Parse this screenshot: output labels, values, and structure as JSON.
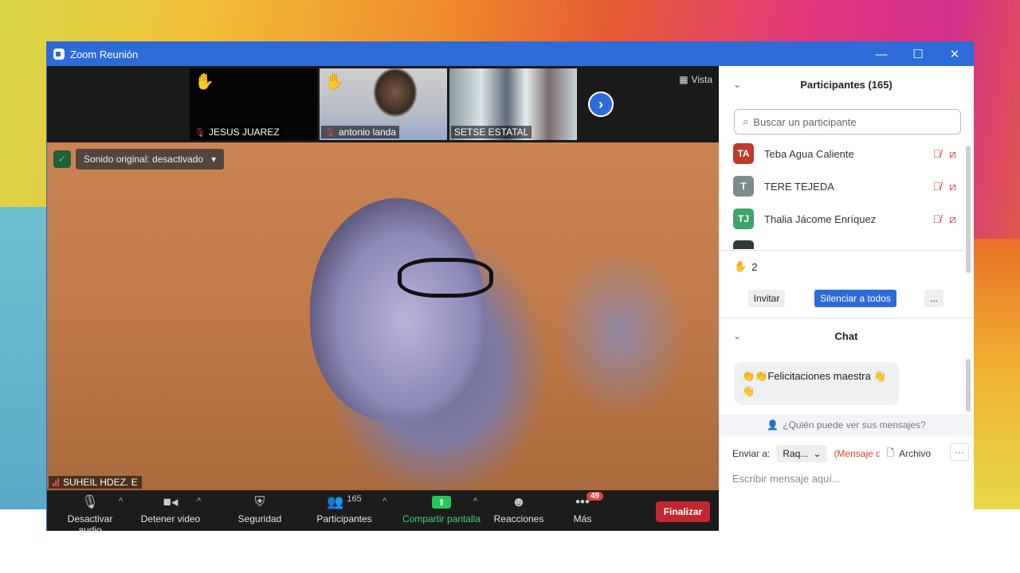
{
  "window": {
    "title": "Zoom Reunión",
    "min_icon": "minimize-icon",
    "max_icon": "maximize-icon",
    "close_icon": "close-icon"
  },
  "strip": {
    "thumbnails": [
      {
        "name": "JESUS JUAREZ",
        "hand": "✋",
        "muted": true
      },
      {
        "name": "antonio landa",
        "hand": "✋",
        "muted": true
      },
      {
        "name": "SETSE ESTATAL",
        "hand": "",
        "muted": false
      }
    ],
    "next_icon": "chevron-right-icon",
    "view_label": "Vista"
  },
  "main_video": {
    "original_sound": "Sonido original: desactivado",
    "speaker": "SUHEIL HDEZ. E"
  },
  "toolbar": {
    "audio": "Desactivar audio",
    "video": "Detener video",
    "security": "Seguridad",
    "participants": "Participantes",
    "participants_count": "165",
    "share": "Compartir pantalla",
    "reactions": "Reacciones",
    "more": "Más",
    "more_badge": "49",
    "end": "Finalizar"
  },
  "participants_panel": {
    "title": "Participantes (165)",
    "search_placeholder": "Buscar un participante",
    "list": [
      {
        "initials": "TA",
        "name": "Teba Agua Caliente",
        "color": "#c0392b"
      },
      {
        "initials": "T",
        "name": "TERE TEJEDA",
        "color": "#7f8c8d"
      },
      {
        "initials": "TJ",
        "name": "Thalia Jácome Enríquez",
        "color": "#3fa36b"
      }
    ],
    "raised_hands_icon": "✋",
    "raised_hands": "2",
    "invite": "Invitar",
    "mute_all": "Silenciar a todos",
    "more": "..."
  },
  "chat": {
    "title": "Chat",
    "messages": [
      {
        "text": "👏👏Felicitaciones maestra 👋 👋"
      }
    ],
    "who_can_see": "¿Quién puede ver sus mensajes?",
    "send_to_label": "Enviar a:",
    "recipient": "Raq...",
    "private_note": "(Mensaje d",
    "file": "Archivo",
    "more": "···",
    "input_placeholder": "Escribir mensaje aquí..."
  }
}
